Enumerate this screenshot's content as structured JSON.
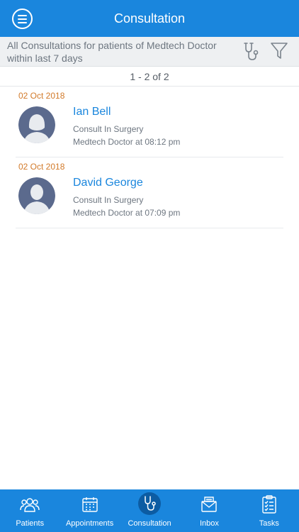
{
  "header": {
    "title": "Consultation"
  },
  "filter": {
    "text": "All Consultations for patients of Medtech Doctor within last 7 days"
  },
  "pager": {
    "text": "1 - 2 of 2"
  },
  "consultations": [
    {
      "date": "02 Oct 2018",
      "name": "Ian Bell",
      "type": "Consult In Surgery",
      "by": "Medtech Doctor at 08:12 pm",
      "avatar": "female-avatar-icon"
    },
    {
      "date": "02 Oct 2018",
      "name": "David George",
      "type": "Consult In Surgery",
      "by": "Medtech Doctor at 07:09 pm",
      "avatar": "male-avatar-icon"
    }
  ],
  "tabs": [
    {
      "label": "Patients",
      "icon": "patients-icon",
      "active": false
    },
    {
      "label": "Appointments",
      "icon": "calendar-icon",
      "active": false
    },
    {
      "label": "Consultation",
      "icon": "stethoscope-icon",
      "active": true
    },
    {
      "label": "Inbox",
      "icon": "inbox-icon",
      "active": false
    },
    {
      "label": "Tasks",
      "icon": "tasks-icon",
      "active": false
    }
  ],
  "colors": {
    "primary": "#1a86dd",
    "active_tab": "#0c5ca3",
    "date": "#d27a2a",
    "avatar_bg": "#5b6a8d"
  }
}
